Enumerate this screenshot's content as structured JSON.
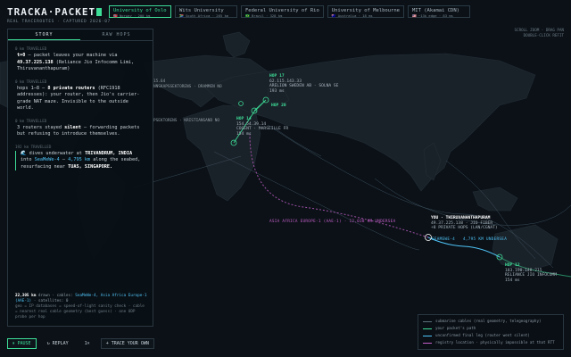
{
  "brand": {
    "title": "TRACKA·PACKET",
    "subtitle": "REAL TRACEROUTES · CAPTURED 2026-07"
  },
  "servers": [
    {
      "name": "University of Oslo",
      "meta": "🇳🇴 Norway · 200 km",
      "active": true
    },
    {
      "name": "Wits University",
      "meta": "🇿🇦 South Africa · 265 km",
      "active": false
    },
    {
      "name": "Federal University of Rio",
      "meta": "🇧🇷 Brazil · 328 km",
      "active": false
    },
    {
      "name": "University of Melbourne",
      "meta": "🇦🇺 Australia · 18 ms",
      "active": false
    },
    {
      "name": "MIT (Akamai CDN)",
      "meta": "🇺🇸 ~13k edge · 83 ms",
      "active": false
    }
  ],
  "hint": {
    "line1": "SCROLL ZOOM · DRAG PAN",
    "line2": "DOUBLE-CLICK REFIT"
  },
  "panel": {
    "tabs": [
      "STORY",
      "RAW HOPS"
    ],
    "entries": [
      {
        "dist": "0 km TRAVELLED",
        "current": false
      },
      {
        "dist": "0 km TRAVELLED",
        "current": false
      },
      {
        "dist": "0 km TRAVELLED",
        "current": false
      },
      {
        "dist": "192 km TRAVELLED",
        "current": true
      }
    ],
    "story": {
      "e1_t": "t=0",
      "e1_a": " — packet leaves your machine via ",
      "e1_ip": "49.37.225.138",
      "e1_b": " (Reliance Jio Infocomm Limi, Thiruvananthapuram)",
      "e2_a": "hops 1–8 — ",
      "e2_b": "8 private routers",
      "e2_c": " (RFC1918 addresses): your router, then Jio's carrier-grade NAT maze. Invisible to the outside world.",
      "e3_a": "3 routers stayed ",
      "e3_b": "silent",
      "e3_c": " — forwarding packets but refusing to introduce themselves.",
      "e4_icon": "🌊",
      "e4_a": " dives underwater at ",
      "e4_b": "TRIVANDRUM, INDIA",
      "e4_c": " into ",
      "e4_d": "SeaMeWe-4",
      "e4_e": " — ",
      "e4_f": "4,795 km",
      "e4_g": " along the seabed, resurfacing near ",
      "e4_h": "TUAS, SINGAPORE."
    },
    "footer": {
      "km": "22,305 km",
      "drawn": " drawn · cables: ",
      "cables": "SeaMeWe-4, Asia Africa Europe-1 (AAE-1)",
      "sat": " · satellites: 0",
      "src": "geo = IP databases = speed-of-light sanity check · cable = nearest real cable geometry (best guess) · one UDP probe per hop"
    }
  },
  "controls": {
    "pause": "⏸ PAUSE",
    "replay": "↻ REPLAY",
    "speed": "1×",
    "trace": "+ TRACE YOUR OWN"
  },
  "legend": [
    {
      "label": "submarine cables (real geometry, telegeography)",
      "color": "#5b6f7d"
    },
    {
      "label": "your packet's path",
      "color": "#3ddc97"
    },
    {
      "label": "unconfirmed final leg (router went silent)",
      "color": "#4fc3f7"
    },
    {
      "label": "registry location · physically impossible at that RTT",
      "color": "#c45fc9"
    }
  ],
  "hops": {
    "h17": {
      "title": "HOP 17",
      "ip": "62.115.143.33",
      "org": "ARELION SWEDEN AB · SOLNA SE",
      "ms": "193 ms"
    },
    "h20": {
      "title": "HOP 20"
    },
    "h14": {
      "title": "HOP 14",
      "ip": "154.54.39.14",
      "org": "COGENT · MARSEILLE FR",
      "ms": "154 ms"
    },
    "you": {
      "title": "YOU · THIRUVANANTHAPURAM",
      "ip": "49.37.225.138 · JIO FIBER",
      "note": "+8 PRIVATE HOPS (LAN/CGNAT)"
    },
    "h12": {
      "title": "HOP 12",
      "ip": "183.190.148.215",
      "org": "RELIANCE JIO INFOCOMM",
      "ms": "154 ms"
    }
  },
  "cities": [
    "15.64",
    "NNSKAPSSEKTORENS · DRAMMEN NO",
    "PSEKTORENS · KRISTIANSAND NO"
  ],
  "cables": {
    "aae": "ASIA AFRICA EUROPE-1 (AAE-1) · 12,038 KM UNDERSEA",
    "smw_a": "SEAMEWE-4",
    "smw_b": "4,795 KM UNDERSEA"
  }
}
